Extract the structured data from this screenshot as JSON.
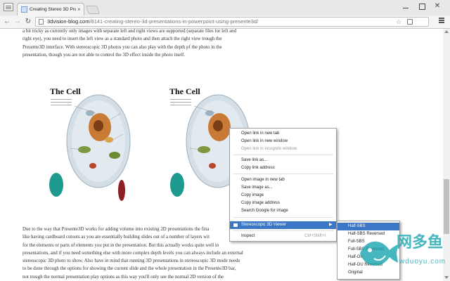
{
  "browser": {
    "tab_title": "Creating Stereo 3D Presen",
    "tab_close": "×",
    "url_host": "3dvision-blog.com",
    "url_path": "/8141-creating-stereo-3d-presentations-in-powerpoint-using-presente3d/",
    "icons": [
      "app-menu-icon",
      "favicon-icon",
      "back-icon",
      "forward-icon",
      "reload-icon",
      "page-icon",
      "star-icon",
      "extension-icon",
      "menu-icon"
    ]
  },
  "article": {
    "para_top": [
      "a bit tricky as currently only images with separate left and right views are supported (separate files for left and",
      "right eye), you need to insert the left view as a standard photo and then attach the right view trough the",
      "Presente3D interface. With stereoscopic 3D photos you can also play with the depth pf the photo in the",
      "presentation, though you are not able to control the 3D effect inside the photo itself."
    ],
    "para_bottom": [
      "Due to the way that Presente3D works for adding volume into existing 2D presentations the fina",
      "like having cardboard cutouts as you are essentially building slides out of a number of layers wit",
      "for the elements or parts of elements you put in the presentation. But this actually works quite well in",
      "presentations, and if you need something else with more complex depth levels you can always include an external",
      "stereoscopic 3D photo to show. Also have in mind that running 3D presentations in stereoscopic 3D mode needs",
      "to be done through the options for showing the current slide and the whole presentation in the Presente3D bar,",
      "not trough the normal presentation play options as this way you'll only see the normal 2D version of the"
    ],
    "figure_title": "The Cell"
  },
  "context_menu": {
    "items": [
      {
        "label": "Open link in new tab",
        "state": "normal"
      },
      {
        "label": "Open link in new window",
        "state": "normal"
      },
      {
        "label": "Open link in incognito window",
        "state": "disabled"
      },
      {
        "label": "Save link as...",
        "state": "normal"
      },
      {
        "label": "Copy link address",
        "state": "normal"
      },
      {
        "label": "Open image in new tab",
        "state": "normal"
      },
      {
        "label": "Save image as...",
        "state": "normal"
      },
      {
        "label": "Copy image",
        "state": "normal"
      },
      {
        "label": "Copy image address",
        "state": "normal"
      },
      {
        "label": "Search Google for image",
        "state": "normal"
      },
      {
        "label": "Stereoscopic 3D Viewer",
        "state": "active"
      },
      {
        "label": "Inspect",
        "shortcut": "Ctrl+Shift+I",
        "state": "normal"
      }
    ],
    "submenu_arrow": "▶"
  },
  "submenu": {
    "items": [
      {
        "label": "Half-SBS",
        "state": "active"
      },
      {
        "label": "Half-SBS Reversed",
        "state": "normal"
      },
      {
        "label": "Full-SBS",
        "state": "normal"
      },
      {
        "label": "Full-SBS Reversed",
        "state": "normal"
      },
      {
        "label": "Half-OU",
        "state": "normal"
      },
      {
        "label": "Half-OU Reversed",
        "state": "normal"
      },
      {
        "label": "Original",
        "state": "normal"
      }
    ]
  },
  "watermark": {
    "title": "网多鱼",
    "url": "wduoyu.com"
  },
  "colors": {
    "menu_highlight": "#3c77c6",
    "cell_body": "#d3dee6",
    "nucleus": "#c97a36",
    "watermark_teal": "#1aa6b0"
  }
}
